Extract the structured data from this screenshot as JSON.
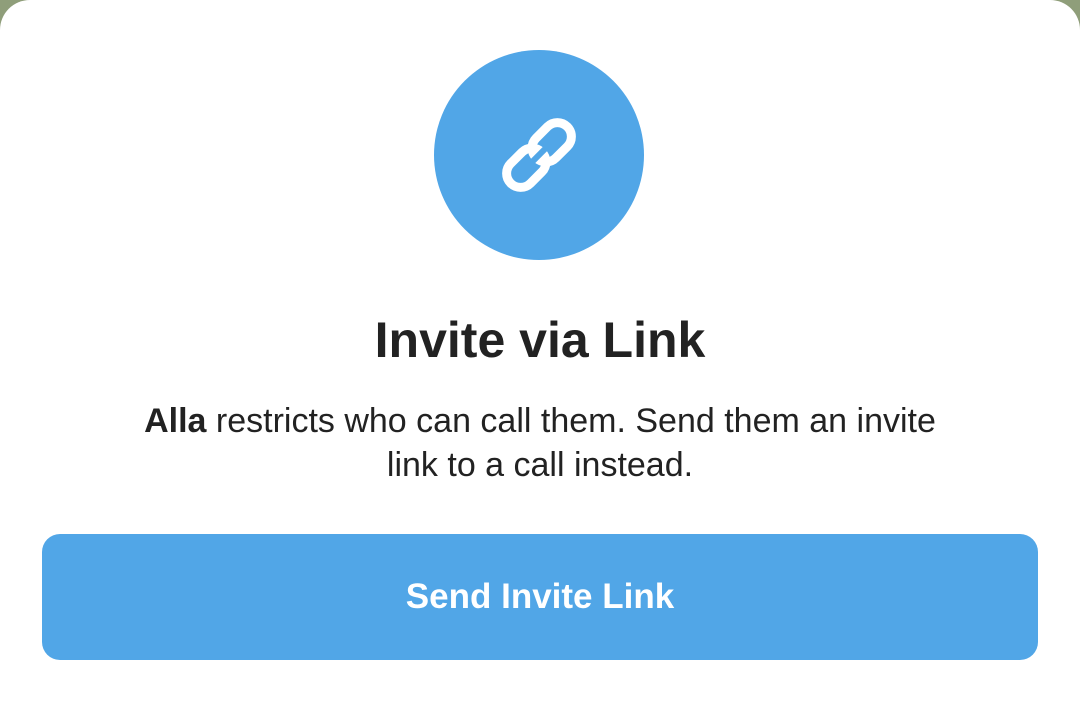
{
  "dialog": {
    "icon": "link-icon",
    "title": "Invite via Link",
    "description_name": "Alla",
    "description_text": " restricts who can call them. Send them an invite link to a call instead.",
    "button_label": "Send Invite Link"
  },
  "colors": {
    "accent": "#51a6e7",
    "text": "#222222",
    "background": "#ffffff"
  }
}
